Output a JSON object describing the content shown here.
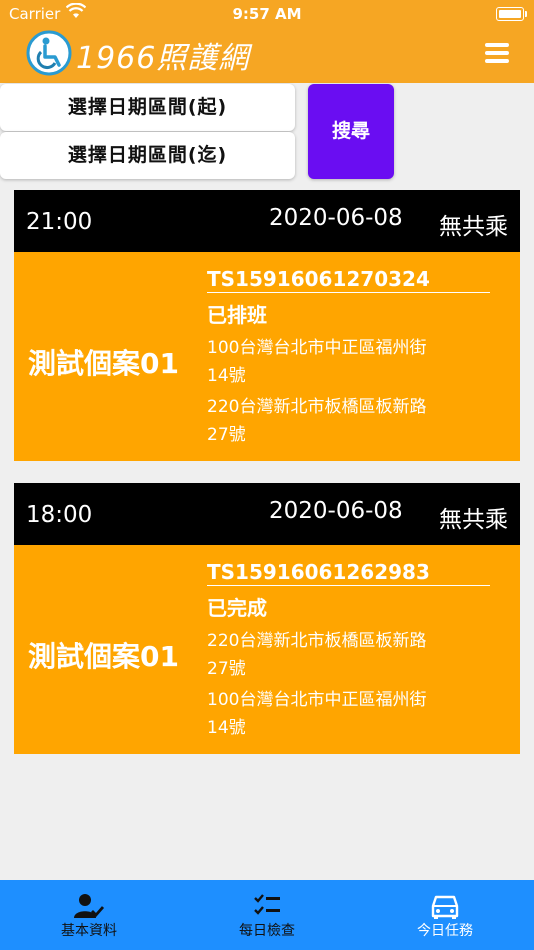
{
  "status_bar": {
    "carrier": "Carrier",
    "time": "9:57 AM"
  },
  "header": {
    "logo_text": "1966照護網"
  },
  "filters": {
    "start_label": "選擇日期區間(起)",
    "end_label": "選擇日期區間(迄)",
    "search_label": "搜尋"
  },
  "cards": [
    {
      "time": "21:00",
      "date": "2020-06-08",
      "carpool": "無共乘",
      "case_name": "測試個案01",
      "id": "TS15916061270324",
      "status": "已排班",
      "address_1": "100台灣台北市中正區福州街14號",
      "address_2": "220台灣新北市板橋區板新路27號"
    },
    {
      "time": "18:00",
      "date": "2020-06-08",
      "carpool": "無共乘",
      "case_name": "測試個案01",
      "id": "TS15916061262983",
      "status": "已完成",
      "address_1": "220台灣新北市板橋區板新路27號",
      "address_2": "100台灣台北市中正區福州街14號"
    }
  ],
  "tabs": [
    {
      "label": "基本資料",
      "icon": "user-check-icon"
    },
    {
      "label": "每日檢查",
      "icon": "checklist-icon"
    },
    {
      "label": "今日任務",
      "icon": "car-icon",
      "active": true
    }
  ],
  "colors": {
    "header": "#f6a623",
    "card_body": "#ffa500",
    "card_head": "#000000",
    "search_button": "#6a0df2",
    "tab_bar": "#1e8fff"
  }
}
